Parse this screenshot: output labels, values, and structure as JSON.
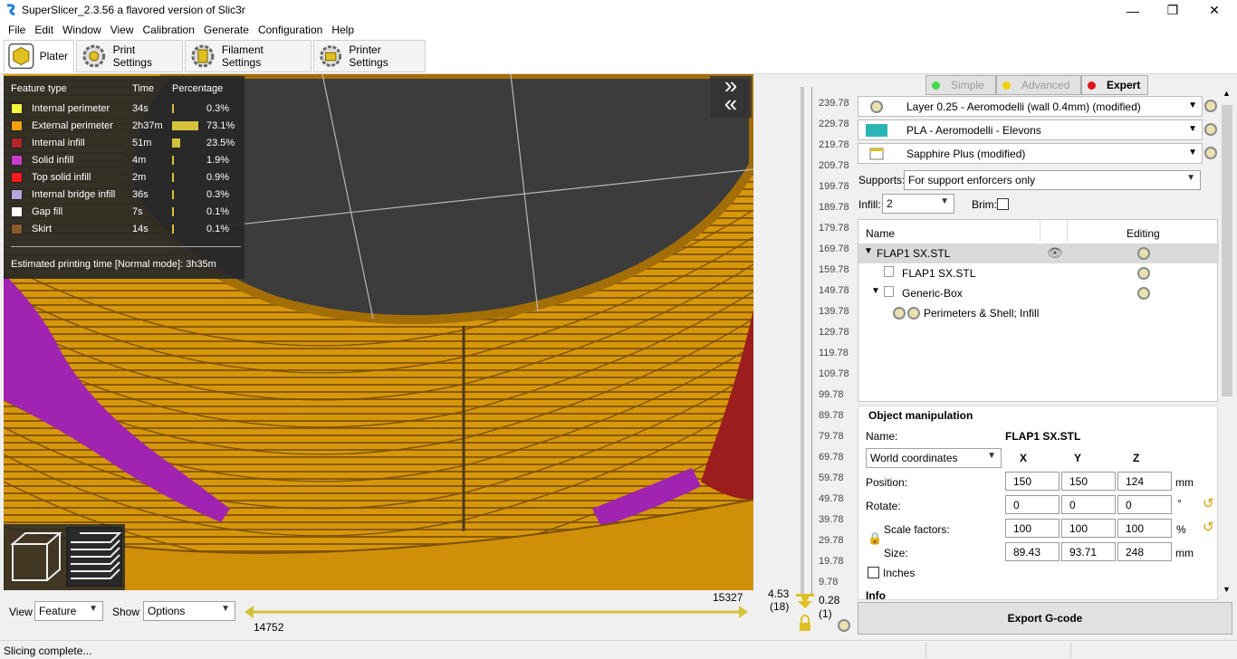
{
  "window": {
    "title": "SuperSlicer_2.3.56 a flavored version of Slic3r",
    "minimize": "—",
    "maximize": "❐",
    "close": "✕"
  },
  "menu": [
    "File",
    "Edit",
    "Window",
    "View",
    "Calibration",
    "Generate",
    "Configuration",
    "Help"
  ],
  "tabs": [
    {
      "label": "Plater",
      "icon": "plater-icon"
    },
    {
      "label": "Print Settings",
      "icon": "print-settings-icon"
    },
    {
      "label": "Filament Settings",
      "icon": "filament-settings-icon"
    },
    {
      "label": "Printer Settings",
      "icon": "printer-settings-icon"
    }
  ],
  "legend": {
    "headers": {
      "feature": "Feature type",
      "time": "Time",
      "percentage": "Percentage"
    },
    "rows": [
      {
        "name": "Internal perimeter",
        "time": "34s",
        "pct": "0.3%",
        "fraction": 0.003,
        "color": "#f5f53c"
      },
      {
        "name": "External perimeter",
        "time": "2h37m",
        "pct": "73.1%",
        "fraction": 0.731,
        "color": "#f5a00a"
      },
      {
        "name": "Internal infill",
        "time": "51m",
        "pct": "23.5%",
        "fraction": 0.235,
        "color": "#b02828"
      },
      {
        "name": "Solid infill",
        "time": "4m",
        "pct": "1.9%",
        "fraction": 0.019,
        "color": "#c83ccc"
      },
      {
        "name": "Top solid infill",
        "time": "2m",
        "pct": "0.9%",
        "fraction": 0.009,
        "color": "#ff1a1a"
      },
      {
        "name": "Internal bridge infill",
        "time": "36s",
        "pct": "0.3%",
        "fraction": 0.003,
        "color": "#b0a8dc"
      },
      {
        "name": "Gap fill",
        "time": "7s",
        "pct": "0.1%",
        "fraction": 0.001,
        "color": "#ffffff"
      },
      {
        "name": "Skirt",
        "time": "14s",
        "pct": "0.1%",
        "fraction": 0.001,
        "color": "#8b5a2b"
      }
    ],
    "estimate_label": "Estimated printing time [Normal mode]:",
    "estimate_value": "3h35m"
  },
  "bottom": {
    "view_label": "View",
    "view_value": "Feature",
    "show_label": "Show",
    "show_value": "Options",
    "h_start": "14752",
    "h_end": "15327"
  },
  "vslider": {
    "ticks": [
      "239.78",
      "229.78",
      "219.78",
      "209.78",
      "199.78",
      "189.78",
      "179.78",
      "169.78",
      "159.78",
      "149.78",
      "139.78",
      "129.78",
      "119.78",
      "109.78",
      "99.78",
      "89.78",
      "79.78",
      "69.78",
      "59.78",
      "49.78",
      "39.78",
      "29.78",
      "19.78",
      "9.78"
    ],
    "lower_value": "4.53",
    "lower_layer": "(18)",
    "upper_value": "0.28",
    "upper_layer": "(1)"
  },
  "modes": {
    "simple": "Simple",
    "advanced": "Advanced",
    "expert": "Expert"
  },
  "presets": {
    "print": "Layer 0.25 - Aeromodelli (wall 0.4mm) (modified)",
    "filament": "PLA - Aeromodelli - Elevons",
    "filament_color": "#2ab5b5",
    "printer": "Sapphire Plus (modified)"
  },
  "supports": {
    "label": "Supports:",
    "value": "For support enforcers only"
  },
  "infill": {
    "label": "Infill:",
    "value": "2"
  },
  "brim": {
    "label": "Brim:"
  },
  "object_list": {
    "col_name": "Name",
    "col_editing": "Editing",
    "rows": [
      {
        "label": "FLAP1 SX.STL"
      },
      {
        "label": "FLAP1 SX.STL"
      },
      {
        "label": "Generic-Box"
      },
      {
        "label": "Perimeters & Shell; Infill"
      }
    ]
  },
  "manipulation": {
    "title": "Object manipulation",
    "name_label": "Name:",
    "name_value": "FLAP1 SX.STL",
    "coords": "World coordinates",
    "x": "X",
    "y": "Y",
    "z": "Z",
    "position_label": "Position:",
    "position": [
      "150",
      "150",
      "124"
    ],
    "position_unit": "mm",
    "rotate_label": "Rotate:",
    "rotate": [
      "0",
      "0",
      "0"
    ],
    "rotate_unit": "°",
    "scale_label": "Scale factors:",
    "scale": [
      "100",
      "100",
      "100"
    ],
    "scale_unit": "%",
    "size_label": "Size:",
    "size": [
      "89.43",
      "93.71",
      "248"
    ],
    "size_unit": "mm",
    "inches_label": "Inches",
    "info_label": "Info"
  },
  "export_label": "Export G-code",
  "status": "Slicing complete..."
}
